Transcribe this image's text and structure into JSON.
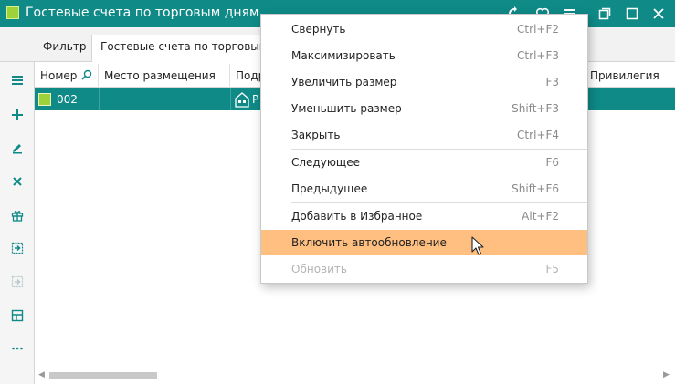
{
  "window": {
    "title": "Гостевые счета по торговым дням",
    "controls": [
      "refresh-icon",
      "heart-icon",
      "menu-icon",
      "restore-icon",
      "maximize-icon",
      "close-icon"
    ]
  },
  "tabs": {
    "filter": "Фильтр",
    "active": "Гостевые счета по торговым д"
  },
  "grid": {
    "columns": {
      "number": "Номер",
      "place": "Место размещения",
      "sub": "Подр",
      "privilege": "Привилегия"
    },
    "row": {
      "number": "002",
      "sub_prefix": "Р"
    }
  },
  "toolbar": [
    "menu-icon",
    "add-icon",
    "edit-icon",
    "delete-icon",
    "gift-icon",
    "export-icon",
    "import-icon",
    "layout-icon",
    "more-icon"
  ],
  "context_menu": {
    "items": [
      {
        "label": "Свернуть",
        "key": "Ctrl+F2"
      },
      {
        "label": "Максимизировать",
        "key": "Ctrl+F3"
      },
      {
        "label": "Увеличить размер",
        "key": "F3"
      },
      {
        "label": "Уменьшить размер",
        "key": "Shift+F3"
      },
      {
        "label": "Закрыть",
        "key": "Ctrl+F4"
      },
      {
        "label": "Следующее",
        "key": "F6"
      },
      {
        "label": "Предыдущее",
        "key": "Shift+F6"
      },
      {
        "label": "Добавить в Избранное",
        "key": "Alt+F2"
      },
      {
        "label": "Включить автообновление",
        "key": ""
      },
      {
        "label": "Обновить",
        "key": "F5"
      }
    ]
  },
  "colors": {
    "accent": "#0f8a87",
    "highlight": "#ffbf80",
    "app_icon": "#9ed13a"
  }
}
